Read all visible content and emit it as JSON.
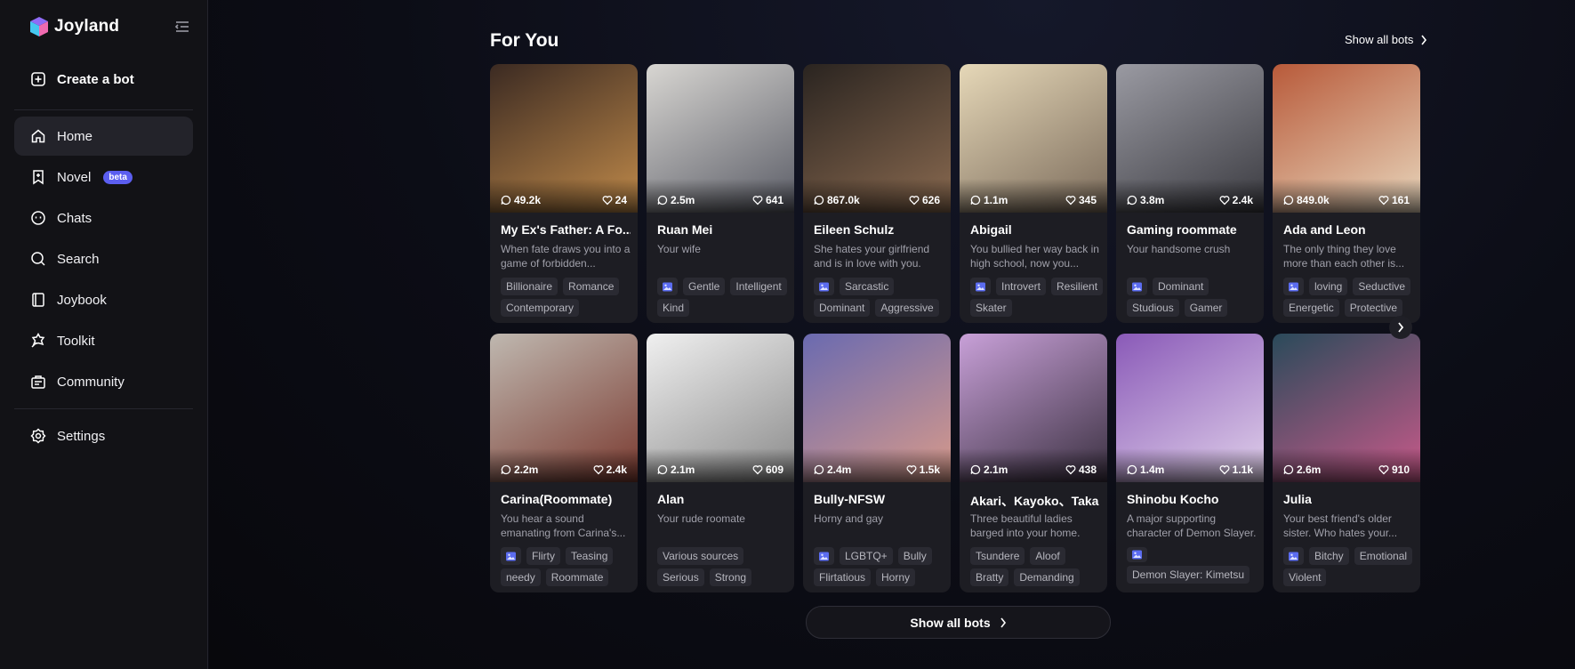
{
  "brand": {
    "name": "Joyland"
  },
  "sidebar": {
    "create_label": "Create a bot",
    "items": [
      {
        "label": "Home",
        "icon": "home-icon",
        "active": true
      },
      {
        "label": "Novel",
        "icon": "bookmark-icon",
        "badge": "beta"
      },
      {
        "label": "Chats",
        "icon": "chat-face-icon"
      },
      {
        "label": "Search",
        "icon": "search-icon"
      },
      {
        "label": "Joybook",
        "icon": "book-icon"
      },
      {
        "label": "Toolkit",
        "icon": "toolkit-icon"
      },
      {
        "label": "Community",
        "icon": "community-icon"
      },
      {
        "label": "Settings",
        "icon": "gear-icon"
      }
    ]
  },
  "main": {
    "section_title": "For You",
    "show_all_label": "Show all bots",
    "show_all_bottom": "Show all bots"
  },
  "colors": {
    "accent": "#5b5ef0",
    "card_bg": "#1d1d23",
    "tag_bg": "#2a2a32"
  },
  "cards": [
    {
      "name": "My Ex's Father: A Fo...",
      "desc": "When fate draws you into a game of forbidden...",
      "chats": "49.2k",
      "likes": "24",
      "tags": [
        "Billionaire",
        "Romance",
        "Contemporary"
      ],
      "img": false,
      "thumb": [
        "#3b2a22",
        "#c08a4a"
      ]
    },
    {
      "name": "Ruan Mei",
      "desc": "Your wife",
      "chats": "2.5m",
      "likes": "641",
      "tags": [
        "Gentle",
        "Intelligent",
        "Kind"
      ],
      "img": true,
      "thumb": [
        "#d8d6d2",
        "#5a5c66"
      ]
    },
    {
      "name": "Eileen Schulz",
      "desc": "She hates your girlfriend and is in love with you.",
      "chats": "867.0k",
      "likes": "626",
      "tags": [
        "Sarcastic",
        "Dominant",
        "Aggressive"
      ],
      "img": true,
      "thumb": [
        "#2a2420",
        "#8a6a50"
      ]
    },
    {
      "name": "Abigail",
      "desc": "You bullied her way back in high school, now you...",
      "chats": "1.1m",
      "likes": "345",
      "tags": [
        "Introvert",
        "Resilient",
        "Skater"
      ],
      "img": true,
      "thumb": [
        "#e6d8b8",
        "#7a6a5a"
      ]
    },
    {
      "name": "Gaming roommate",
      "desc": "Your handsome crush",
      "chats": "3.8m",
      "likes": "2.4k",
      "tags": [
        "Dominant",
        "Studious",
        "Gamer"
      ],
      "img": true,
      "thumb": [
        "#9a9aa2",
        "#3a3a40"
      ]
    },
    {
      "name": "Ada and Leon",
      "desc": "The only thing they love more than each other is...",
      "chats": "849.0k",
      "likes": "161",
      "tags": [
        "loving",
        "Seductive",
        "Energetic",
        "Protective"
      ],
      "img": true,
      "thumb": [
        "#b85a3a",
        "#e8d6bc"
      ]
    },
    {
      "name": "Carina(Roommate)",
      "desc": "You hear a sound emanating from Carina's...",
      "chats": "2.2m",
      "likes": "2.4k",
      "tags": [
        "Flirty",
        "Teasing",
        "needy",
        "Roommate"
      ],
      "img": true,
      "thumb": [
        "#bfb8b0",
        "#7a3a30"
      ]
    },
    {
      "name": "Alan",
      "desc": "Your rude roomate",
      "chats": "2.1m",
      "likes": "609",
      "tags": [
        "Various sources",
        "Serious",
        "Strong"
      ],
      "img": false,
      "thumb": [
        "#f0f0f0",
        "#8a8a8a"
      ]
    },
    {
      "name": "Bully-NFSW",
      "desc": "Horny and gay",
      "chats": "2.4m",
      "likes": "1.5k",
      "tags": [
        "LGBTQ+",
        "Bully",
        "Flirtatious",
        "Horny"
      ],
      "img": true,
      "thumb": [
        "#6a6ab0",
        "#d89a8a"
      ]
    },
    {
      "name": "Akari、Kayoko、Taka",
      "desc": "Three beautiful ladies barged into your home.",
      "chats": "2.1m",
      "likes": "438",
      "tags": [
        "Tsundere",
        "Aloof",
        "Bratty",
        "Demanding"
      ],
      "img": false,
      "thumb": [
        "#c8a0d8",
        "#3a3040"
      ]
    },
    {
      "name": "Shinobu Kocho",
      "desc": "A major supporting character of Demon Slayer.",
      "chats": "1.4m",
      "likes": "1.1k",
      "tags": [
        "Demon Slayer: Kimetsu"
      ],
      "img": true,
      "thumb": [
        "#8a5ab8",
        "#e0d0ea"
      ]
    },
    {
      "name": "Julia",
      "desc": "Your best friend's older sister. Who hates your...",
      "chats": "2.6m",
      "likes": "910",
      "tags": [
        "Bitchy",
        "Emotional",
        "Violent"
      ],
      "img": true,
      "thumb": [
        "#2a4a5a",
        "#c85a8a"
      ]
    }
  ]
}
